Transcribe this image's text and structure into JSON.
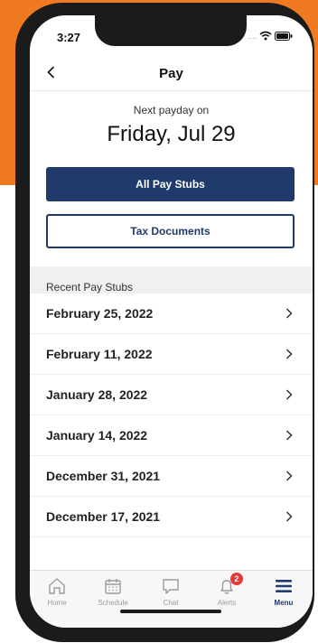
{
  "status_bar": {
    "time": "3:27",
    "signal_dots": "...."
  },
  "nav": {
    "title": "Pay",
    "back_icon": "chevron-left-icon"
  },
  "payday": {
    "label": "Next payday on",
    "date": "Friday, Jul 29"
  },
  "buttons": {
    "all_pay_stubs": "All Pay Stubs",
    "tax_documents": "Tax Documents"
  },
  "recent": {
    "header": "Recent Pay Stubs",
    "items": [
      {
        "label": "February 25, 2022"
      },
      {
        "label": "February 11, 2022"
      },
      {
        "label": "January 28, 2022"
      },
      {
        "label": "January 14, 2022"
      },
      {
        "label": "December 31, 2021"
      },
      {
        "label": "December 17, 2021"
      }
    ]
  },
  "tabs": [
    {
      "label": "Home",
      "icon": "home-icon"
    },
    {
      "label": "Schedule",
      "icon": "calendar-icon"
    },
    {
      "label": "Chat",
      "icon": "chat-icon"
    },
    {
      "label": "Alerts",
      "icon": "bell-icon",
      "badge": "2"
    },
    {
      "label": "Menu",
      "icon": "menu-icon",
      "active": true
    }
  ],
  "colors": {
    "brand_orange": "#ef7a22",
    "primary_navy": "#1f3a6b",
    "badge_red": "#e53935"
  }
}
